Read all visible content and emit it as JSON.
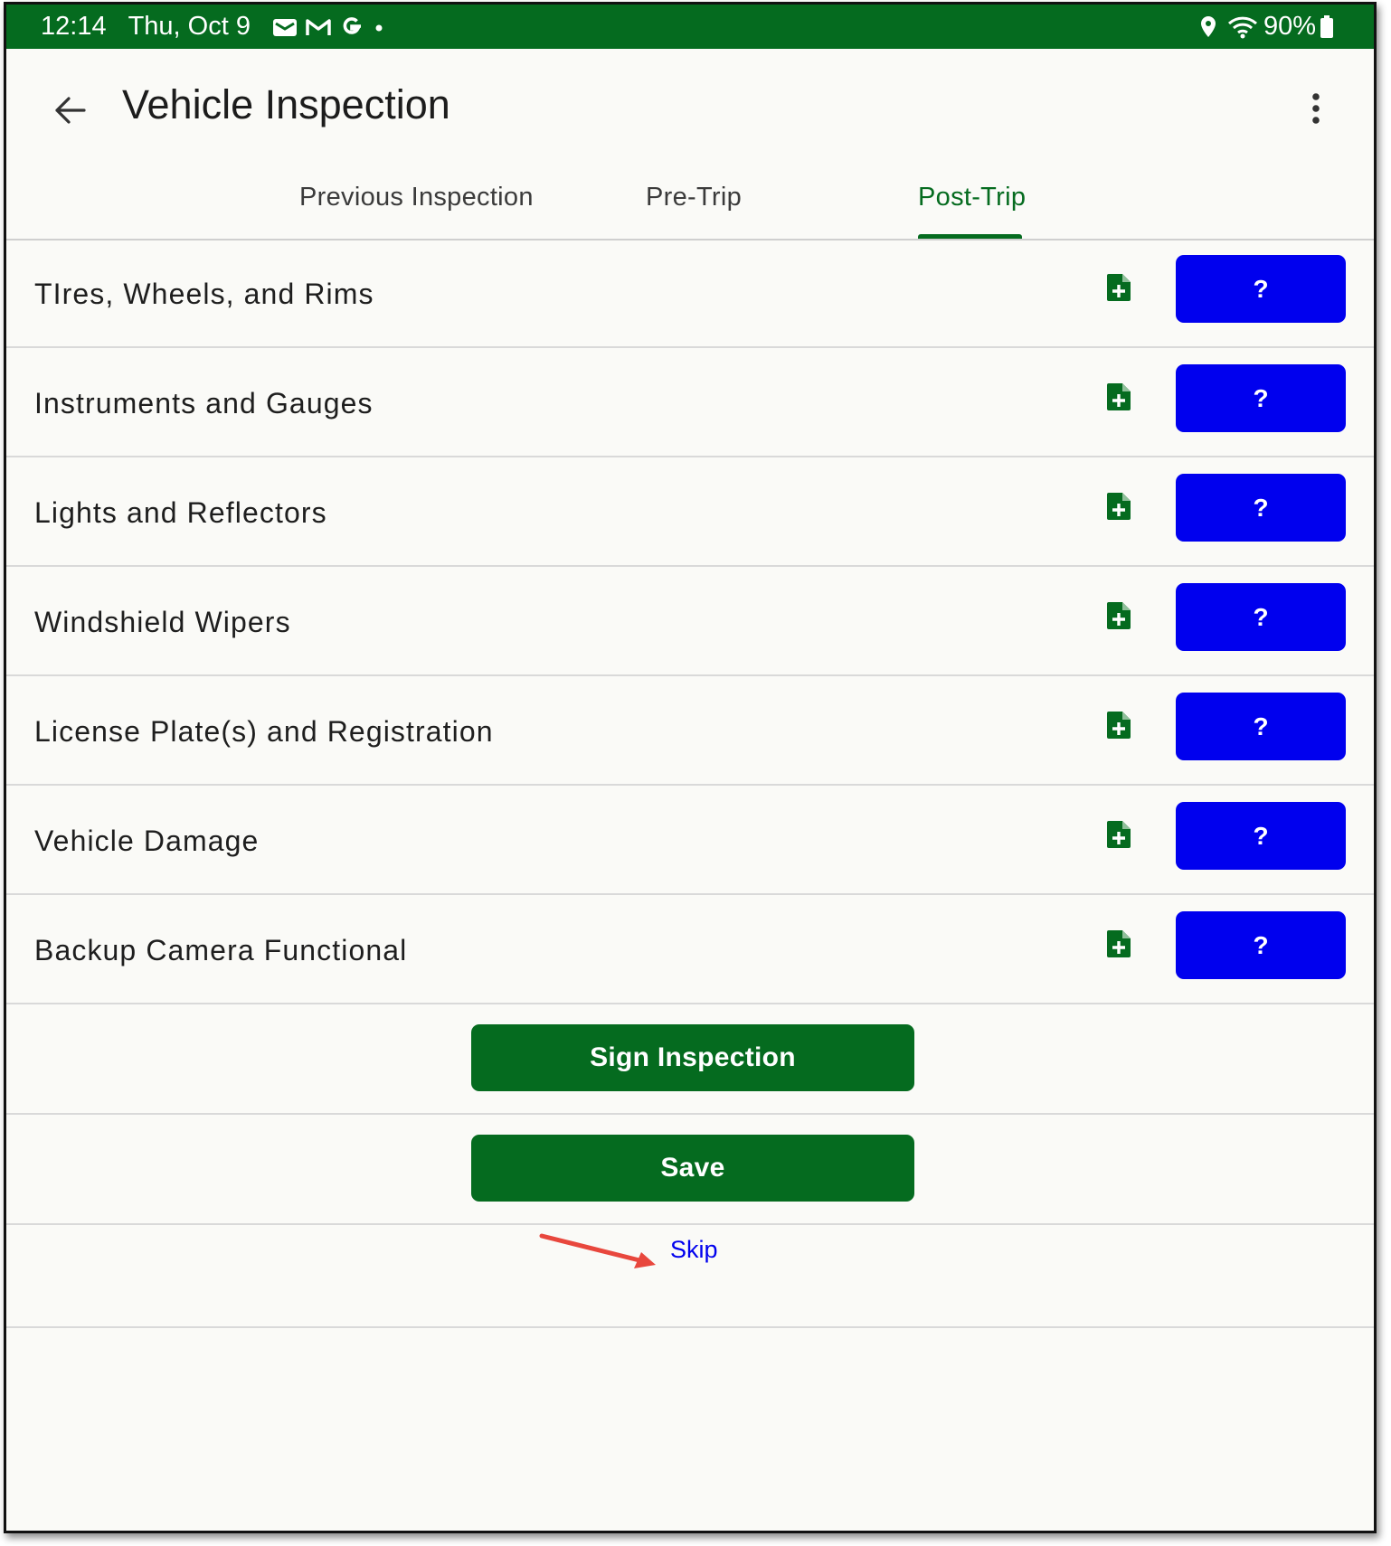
{
  "status_bar": {
    "time": "12:14",
    "date": "Thu, Oct 9",
    "notification_icons": [
      "mail-icon",
      "gmail-icon",
      "google-icon",
      "dot-icon"
    ],
    "battery": "90%",
    "right_icons": [
      "location-icon",
      "wifi-icon",
      "battery-icon"
    ]
  },
  "app_bar": {
    "title": "Vehicle Inspection",
    "back_icon": "arrow-back-icon",
    "menu_icon": "more-vert-icon"
  },
  "tabs": [
    {
      "label": "Previous Inspection",
      "active": false
    },
    {
      "label": "Pre-Trip",
      "active": false
    },
    {
      "label": "Post-Trip",
      "active": true
    }
  ],
  "inspection_items": [
    {
      "label": "TIres, Wheels, and Rims",
      "button": "?"
    },
    {
      "label": "Instruments and Gauges",
      "button": "?"
    },
    {
      "label": "Lights and Reflectors",
      "button": "?"
    },
    {
      "label": "Windshield Wipers",
      "button": "?"
    },
    {
      "label": "License Plate(s) and Registration",
      "button": "?"
    },
    {
      "label": "Vehicle Damage",
      "button": "?"
    },
    {
      "label": "Backup Camera Functional",
      "button": "?"
    }
  ],
  "actions": {
    "sign_label": "Sign Inspection",
    "save_label": "Save",
    "skip_label": "Skip"
  },
  "colors": {
    "brand_green": "#056b1f",
    "help_blue": "#0000ee",
    "annotation_arrow": "#e8473d"
  }
}
